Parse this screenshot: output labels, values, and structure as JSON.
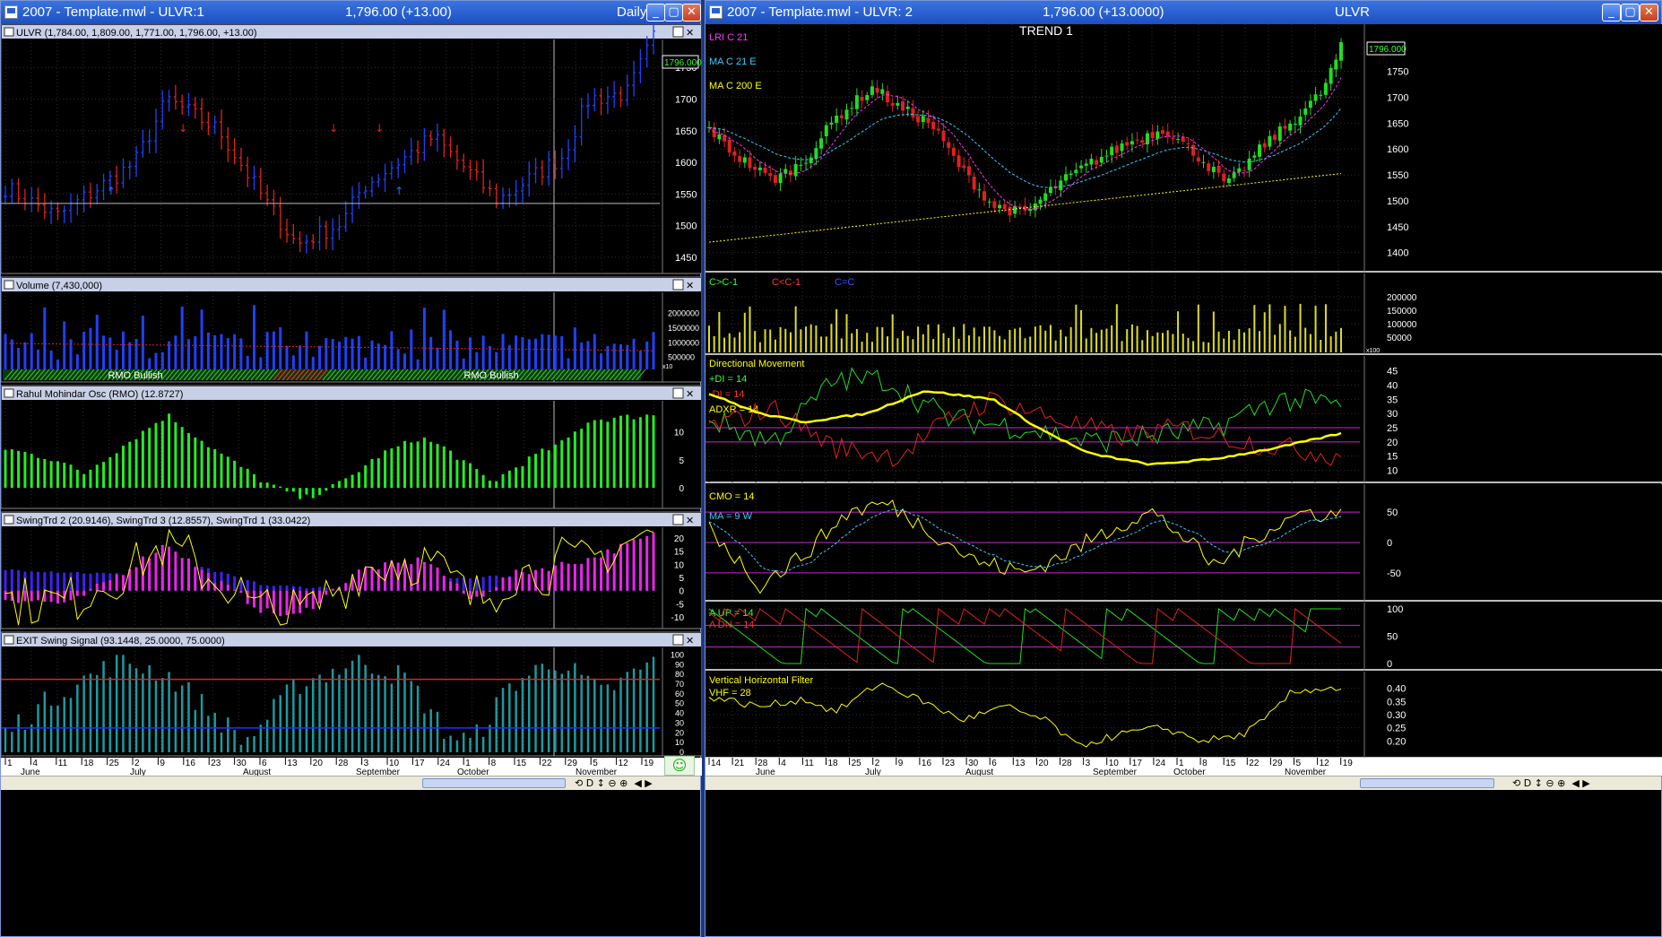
{
  "windows": [
    {
      "title": "2007 - Template.mwl - ULVR:1",
      "price": "1,796.00 (+13.00)",
      "period": "Daily",
      "panes": [
        {
          "title": "ULVR (1,784.00, 1,809.00, 1,771.00, 1,796.00, +13.00)",
          "ticks": [
            "1750",
            "1700",
            "1650",
            "1600",
            "1550",
            "1500",
            "1450"
          ],
          "box": "1796.000"
        },
        {
          "title": "Volume (7,430,000)",
          "ticks": [
            "2000000",
            "1500000",
            "1000000",
            "500000"
          ],
          "labels": [
            "RMO Bullish",
            "RMO Bullish"
          ],
          "unit": "x10"
        },
        {
          "title": "Rahul Mohindar Osc (RMO) (12.8727)",
          "ticks": [
            "10",
            "5",
            "0"
          ]
        },
        {
          "title": "SwingTrd 2 (20.9146), SwingTrd 3 (12.8557), SwingTrd 1 (33.0422)",
          "ticks": [
            "20",
            "15",
            "10",
            "5",
            "0",
            "-5",
            "-10"
          ]
        },
        {
          "title": "EXIT Swing Signal (93.1448, 25.0000, 75.0000)",
          "ticks": [
            "100",
            "90",
            "80",
            "70",
            "60",
            "50",
            "40",
            "30",
            "20",
            "10",
            "0"
          ]
        }
      ],
      "xaxis": {
        "days": [
          "1",
          "4",
          "11",
          "18",
          "25",
          "2",
          "9",
          "16",
          "23",
          "30",
          "6",
          "13",
          "20",
          "28",
          "3",
          "10",
          "17",
          "24",
          "1",
          "8",
          "15",
          "22",
          "29",
          "5",
          "12",
          "19"
        ],
        "months": [
          "June",
          "July",
          "August",
          "September",
          "October",
          "November"
        ]
      }
    },
    {
      "title": "2007 - Template.mwl - ULVR: 2",
      "price": "1,796.00 (+13.0000)",
      "symbol": "ULVR",
      "panes": [
        {
          "title": "TREND 1",
          "legend": [
            {
              "text": "LRI C 21",
              "color": "#ff33ff"
            },
            {
              "text": "MA C 21 E",
              "color": "#33ccff"
            },
            {
              "text": "MA C 200 E",
              "color": "#ffff00"
            }
          ],
          "ticks": [
            "1750",
            "1700",
            "1650",
            "1600",
            "1550",
            "1500",
            "1450",
            "1400"
          ],
          "box": "1796.000"
        },
        {
          "legend": [
            {
              "text": "C>C-1",
              "color": "#33ff33"
            },
            {
              "text": "C<C-1",
              "color": "#ff3333"
            },
            {
              "text": "C=C",
              "color": "#3355ff"
            }
          ],
          "ticks": [
            "200000",
            "150000",
            "100000",
            "50000"
          ],
          "unit": "x100"
        },
        {
          "legend": [
            {
              "text": "Directional Movement",
              "color": "#ffff00"
            },
            {
              "text": "+DI = 14",
              "color": "#33ff33"
            },
            {
              "text": "-DI = 14",
              "color": "#ff3333"
            },
            {
              "text": "ADXR = 14",
              "color": "#ffff00"
            }
          ],
          "ticks": [
            "45",
            "40",
            "35",
            "30",
            "25",
            "20",
            "15",
            "10"
          ]
        },
        {
          "legend": [
            {
              "text": "CMO = 14",
              "color": "#ffff00"
            },
            {
              "text": "MA = 9 W",
              "color": "#33ccff"
            }
          ],
          "ticks": [
            "50",
            "0",
            "-50"
          ]
        },
        {
          "legend": [
            {
              "text": "A UP = 14",
              "color": "#33ff33"
            },
            {
              "text": "A DN = 14",
              "color": "#ff3333"
            }
          ],
          "ticks": [
            "100",
            "50",
            "0"
          ]
        },
        {
          "legend": [
            {
              "text": "Vertical Horizontal Filter",
              "color": "#ffff00"
            },
            {
              "text": "VHF = 28",
              "color": "#ffff00"
            }
          ],
          "ticks": [
            "0.40",
            "0.35",
            "0.30",
            "0.25",
            "0.20"
          ]
        }
      ],
      "xaxis": {
        "days": [
          "14",
          "21",
          "28",
          "4",
          "11",
          "18",
          "25",
          "2",
          "9",
          "16",
          "23",
          "30",
          "6",
          "13",
          "20",
          "28",
          "3",
          "10",
          "17",
          "24",
          "1",
          "8",
          "15",
          "22",
          "29",
          "5",
          "12",
          "19"
        ],
        "months": [
          "June",
          "July",
          "August",
          "September",
          "October",
          "November"
        ]
      }
    }
  ],
  "chart_data": [
    {
      "type": "line",
      "series": [
        {
          "name": "ULVR",
          "x": [
            "2007-06-01",
            "2007-06-15",
            "2007-07-02",
            "2007-07-12",
            "2007-07-24",
            "2007-08-03",
            "2007-08-10",
            "2007-08-20",
            "2007-09-03",
            "2007-09-20",
            "2007-10-01",
            "2007-10-10",
            "2007-10-25",
            "2007-11-05",
            "2007-11-15",
            "2007-11-19"
          ],
          "values": [
            1560,
            1520,
            1610,
            1700,
            1650,
            1510,
            1470,
            1510,
            1550,
            1640,
            1590,
            1540,
            1600,
            1700,
            1700,
            1796
          ]
        }
      ],
      "ylim": [
        1430,
        1790
      ]
    },
    {
      "type": "bar",
      "series": [
        {
          "name": "Volume",
          "values": [
            7430000
          ]
        }
      ],
      "ylim": [
        0,
        2600000
      ]
    },
    {
      "type": "bar",
      "series": [
        {
          "name": "RMO",
          "x": [
            "2007-06-01",
            "2007-06-20",
            "2007-07-05",
            "2007-07-16",
            "2007-08-01",
            "2007-08-13",
            "2007-09-10",
            "2007-09-24",
            "2007-10-08",
            "2007-10-29",
            "2007-11-19"
          ],
          "values": [
            7,
            3,
            9,
            13,
            5,
            -2,
            5,
            9,
            2,
            8,
            12.8727
          ]
        }
      ],
      "ylim": [
        -3,
        15
      ]
    },
    {
      "type": "line",
      "series": [
        {
          "name": "SwingTrd 2",
          "values": [
            20.9146
          ]
        },
        {
          "name": "SwingTrd 3",
          "values": [
            12.8557
          ]
        },
        {
          "name": "SwingTrd 1",
          "values": [
            33.0422
          ]
        }
      ],
      "ylim": [
        -13,
        23
      ]
    },
    {
      "type": "bar",
      "series": [
        {
          "name": "EXIT Swing Signal",
          "values": [
            93.1448
          ]
        }
      ],
      "ylim": [
        0,
        105
      ]
    },
    {
      "type": "line",
      "series": [
        {
          "name": "LRI C 21",
          "values": [
            1796
          ]
        },
        {
          "name": "MA C 21 E",
          "values": [
            1700
          ]
        },
        {
          "name": "MA C 200 E",
          "x": [
            "2007-05-14",
            "2007-08-20",
            "2007-11-19"
          ],
          "values": [
            1420,
            1495,
            1555
          ]
        }
      ],
      "ylim": [
        1370,
        1810
      ]
    },
    {
      "type": "line",
      "series": [
        {
          "name": "+DI = 14",
          "values": [
            33
          ]
        },
        {
          "name": "-DI = 14",
          "values": [
            15
          ]
        },
        {
          "name": "ADXR = 14",
          "x": [
            "2007-05-14",
            "2007-07-20",
            "2007-09-10",
            "2007-10-08",
            "2007-11-19"
          ],
          "values": [
            38,
            36,
            12,
            14,
            23
          ]
        }
      ],
      "ylim": [
        7,
        49
      ]
    },
    {
      "type": "line",
      "series": [
        {
          "name": "CMO = 14",
          "values": [
            45
          ]
        },
        {
          "name": "MA = 9 W",
          "values": [
            35
          ]
        }
      ],
      "ylim": [
        -90,
        90
      ]
    },
    {
      "type": "line",
      "series": [
        {
          "name": "A UP = 14",
          "values": [
            100
          ]
        },
        {
          "name": "A DN = 14",
          "values": [
            10
          ]
        }
      ],
      "ylim": [
        -5,
        105
      ]
    },
    {
      "type": "line",
      "series": [
        {
          "name": "VHF = 28",
          "values": [
            0.4
          ]
        }
      ],
      "ylim": [
        0.15,
        0.45
      ]
    }
  ],
  "ui": {
    "colors": {
      "up": "#2040ff",
      "down": "#e02020",
      "grid": "#3a3a3a",
      "grid_dotted": "#2e2e2e"
    },
    "icons": [
      "window-icon",
      "minimize-icon",
      "maximize-icon",
      "close-icon",
      "pane-maximize-icon",
      "pane-close-icon",
      "smiley-icon"
    ],
    "scroll_nav": [
      "⟲",
      "D",
      "↕",
      "⊖",
      "⊕",
      "◀",
      "▶"
    ]
  }
}
